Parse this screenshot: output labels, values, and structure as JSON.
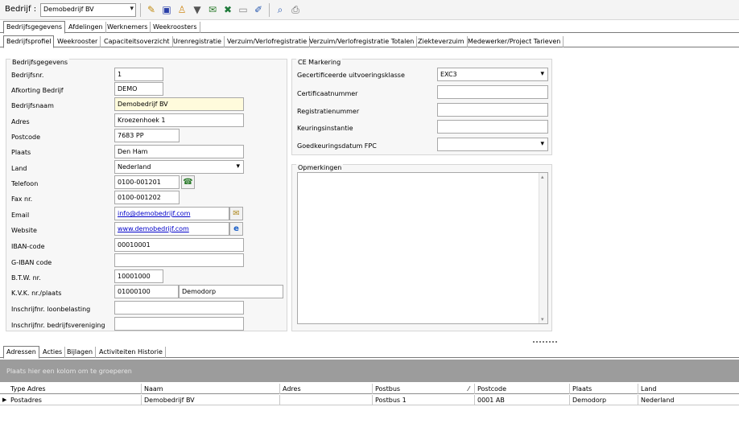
{
  "toolbar": {
    "company_label": "Bedrijf :",
    "company_value": "Demobedrijf BV"
  },
  "main_tabs": [
    "Bedrijfsgegevens",
    "Afdelingen",
    "Werknemers",
    "Weekroosters"
  ],
  "sub_tabs": [
    "Bedrijfsprofiel",
    "Weekrooster",
    "Capaciteitsoverzicht",
    "Urenregistratie",
    "Verzuim/Verlofregistratie",
    "Verzuim/Verlofregistratie Totalen",
    "Ziekteverzuim",
    "Medewerker/Project Tarieven"
  ],
  "company": {
    "title": "Bedrijfsgegevens",
    "labels": {
      "nr": "Bedrijfsnr.",
      "afk": "Afkorting Bedrijf",
      "naam": "Bedrijfsnaam",
      "adres": "Adres",
      "postcode": "Postcode",
      "plaats": "Plaats",
      "land": "Land",
      "telefoon": "Telefoon",
      "fax": "Fax nr.",
      "email": "Email",
      "website": "Website",
      "iban": "IBAN-code",
      "giban": "G-IBAN code",
      "btw": "B.T.W. nr.",
      "kvk": "K.V.K. nr./plaats",
      "loonbelasting": "Inschrijfnr. loonbelasting",
      "vereniging": "Inschrijfnr. bedrijfsvereniging"
    },
    "values": {
      "nr": "1",
      "afk": "DEMO",
      "naam": "Demobedrijf BV",
      "adres": "Kroezenhoek 1",
      "postcode": "7683 PP",
      "plaats": "Den Ham",
      "land": "Nederland",
      "telefoon": "0100-001201",
      "fax": "0100-001202",
      "email": "info@demobedrijf.com",
      "website": "www.demobedrijf.com",
      "iban": "00010001",
      "giban": "",
      "btw": "10001000",
      "kvk_nr": "01000100",
      "kvk_plaats": "Demodorp",
      "loonbelasting": "",
      "vereniging": ""
    }
  },
  "ce": {
    "title": "CE Markering",
    "labels": {
      "klasse": "Gecertificeerde uitvoeringsklasse",
      "cert": "Certificaatnummer",
      "reg": "Registratienummer",
      "keuring": "Keuringsinstantie",
      "datum": "Goedkeuringsdatum FPC"
    },
    "values": {
      "klasse": "EXC3",
      "cert": "",
      "reg": "",
      "keuring": "",
      "datum": ""
    }
  },
  "opmerkingen": {
    "title": "Opmerkingen",
    "value": ""
  },
  "bottom_tabs": [
    "Adressen",
    "Acties",
    "Bijlagen",
    "Activiteiten Historie"
  ],
  "grid": {
    "group_hint": "Plaats hier een kolom om te groeperen",
    "columns": [
      "Type Adres",
      "Naam",
      "Adres",
      "Postbus",
      "Postcode",
      "Plaats",
      "Land"
    ],
    "rows": [
      [
        "Postadres",
        "Demobedrijf BV",
        "",
        "Postbus 1",
        "0001 AB",
        "Demodorp",
        "Nederland"
      ]
    ]
  },
  "colors": {
    "group_bar": "#9c9c9c",
    "link": "#0000c8",
    "highlight_field": "#fffbdc"
  }
}
